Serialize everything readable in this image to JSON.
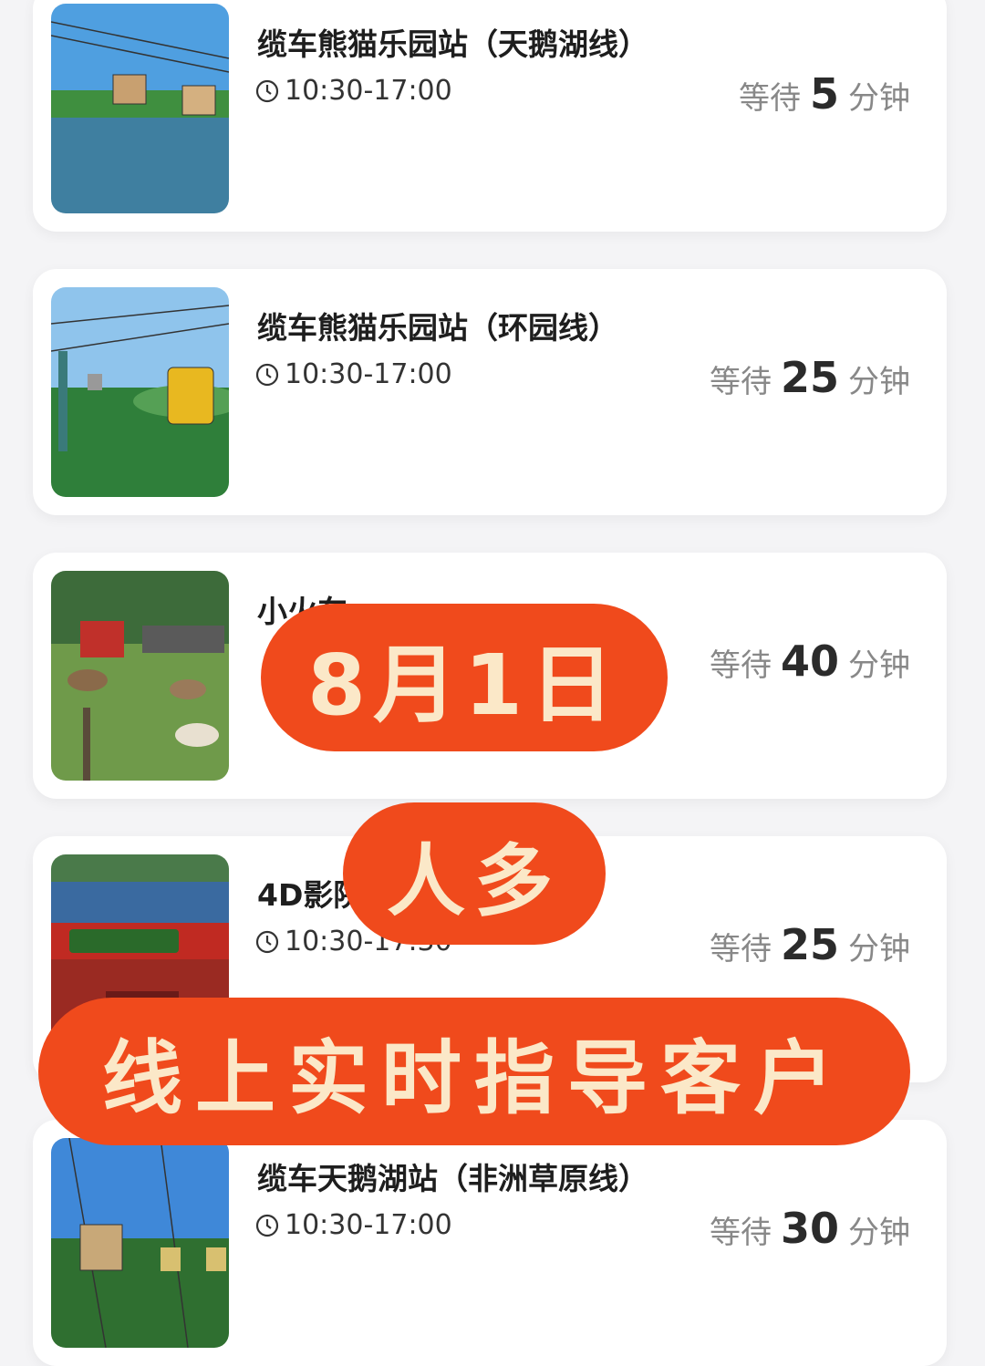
{
  "items": [
    {
      "title": "缆车熊猫乐园站（天鹅湖线）",
      "time": "10:30-17:00",
      "wait_prefix": "等待",
      "wait_value": "5",
      "wait_unit": "分钟",
      "image": "cable-car-lake-photo"
    },
    {
      "title": "缆车熊猫乐园站（环园线）",
      "time": "10:30-17:00",
      "wait_prefix": "等待",
      "wait_value": "25",
      "wait_unit": "分钟",
      "image": "cable-car-forest-photo"
    },
    {
      "title": "小火车",
      "time": "",
      "wait_prefix": "等待",
      "wait_value": "40",
      "wait_unit": "分钟",
      "image": "train-antelope-photo"
    },
    {
      "title": "4D影院",
      "time": "10:30-17:30",
      "wait_prefix": "等待",
      "wait_value": "25",
      "wait_unit": "分钟",
      "image": "4d-theatre-photo"
    },
    {
      "title": "缆车天鹅湖站（非洲草原线）",
      "time": "10:30-17:00",
      "wait_prefix": "等待",
      "wait_value": "30",
      "wait_unit": "分钟",
      "image": "cable-car-savanna-photo"
    }
  ],
  "overlay": {
    "date": "8月1日",
    "crowd": "人多",
    "guide": "线上实时指导客户"
  },
  "colors": {
    "overlay_bg": "#f04a1c",
    "overlay_text": "#fbe8c8",
    "card_bg": "#ffffff"
  }
}
